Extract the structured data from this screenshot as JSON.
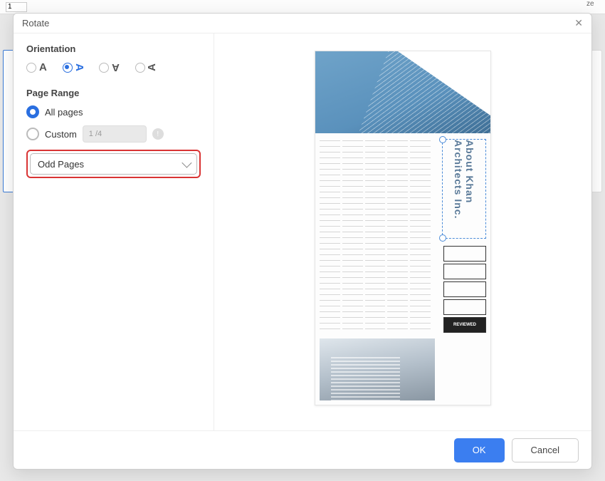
{
  "backdrop": {
    "page_input": "1",
    "right_label": "ze"
  },
  "dialog": {
    "title": "Rotate",
    "orientation": {
      "label": "Orientation",
      "options": [
        "A",
        "A",
        "A",
        "A"
      ],
      "selected_index": 1
    },
    "page_range": {
      "label": "Page Range",
      "all_label": "All pages",
      "custom_label": "Custom",
      "custom_value": "1 /4",
      "selected": "all",
      "subset_selected": "Odd Pages"
    },
    "preview": {
      "title_line1": "About Khan",
      "title_line2": "Architects Inc.",
      "stamp_reviewed": "REVIEWED"
    },
    "footer": {
      "ok": "OK",
      "cancel": "Cancel"
    }
  }
}
